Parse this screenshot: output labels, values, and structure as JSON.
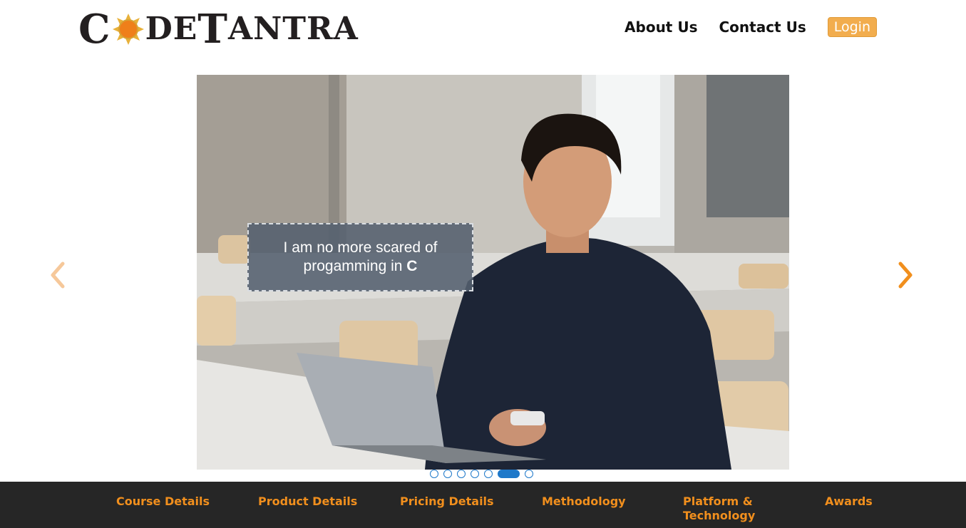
{
  "header": {
    "logo": {
      "text_before": "C",
      "text_after_big": "DE",
      "text_t": "T",
      "text_rest": "ANTRA",
      "icon": "sun-icon"
    },
    "nav": {
      "about": "About Us",
      "contact": "Contact Us",
      "login": "Login"
    }
  },
  "carousel": {
    "caption_line1": "I am no more scared of",
    "caption_line2": "progamming in ",
    "caption_bold": "C",
    "slide_count": 7,
    "active_slide": 6,
    "prev_icon": "chevron-left-icon",
    "next_icon": "chevron-right-icon"
  },
  "bottom_nav": {
    "items": [
      {
        "line1": "Course Details",
        "line2": ""
      },
      {
        "line1": "Product Details",
        "line2": ""
      },
      {
        "line1": "Pricing Details",
        "line2": ""
      },
      {
        "line1": "Methodology",
        "line2": ""
      },
      {
        "line1": "Platform &",
        "line2": "Technology"
      },
      {
        "line1": "Awards",
        "line2": ""
      }
    ]
  },
  "colors": {
    "accent": "#f18f1d",
    "login_bg": "#f2ad4e",
    "dot_blue": "#1f79c9",
    "bar_bg": "#262626"
  }
}
